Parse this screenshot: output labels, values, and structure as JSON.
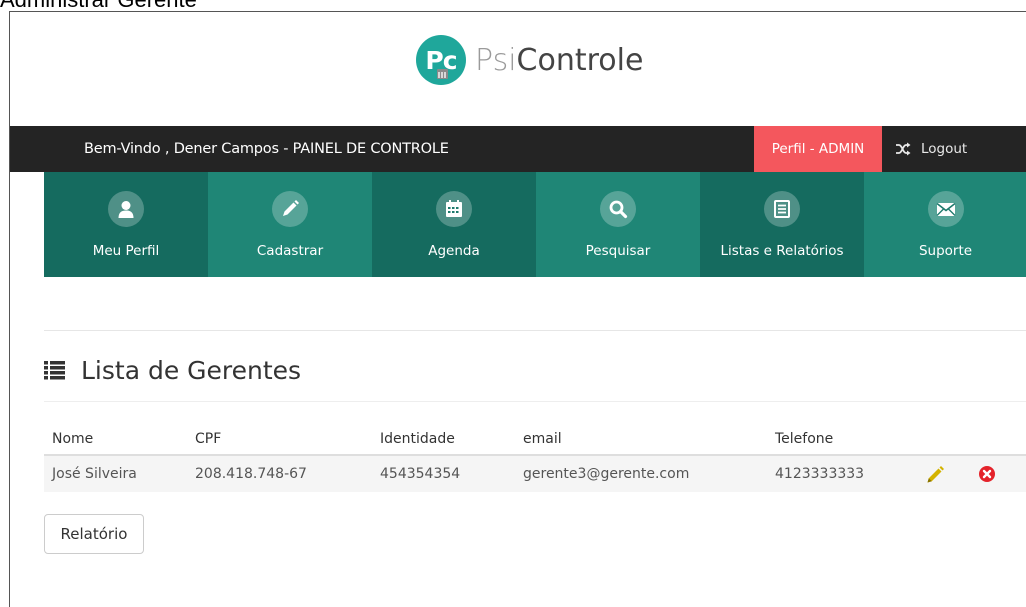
{
  "page_caption": "Administrar Gerente",
  "logo": {
    "badge": "Pc",
    "psi": "Psi",
    "controle": "Controle"
  },
  "topbar": {
    "welcome": "Bem-Vindo , Dener  Campos - PAINEL DE CONTROLE",
    "profile_button": "Perfil - ADMIN",
    "logout": "Logout"
  },
  "nav": {
    "items": [
      {
        "label": "Meu Perfil",
        "icon": "user-icon",
        "color": "#156b5f"
      },
      {
        "label": "Cadastrar",
        "icon": "pencil-icon",
        "color": "#1f8676"
      },
      {
        "label": "Agenda",
        "icon": "calendar-icon",
        "color": "#156b5f"
      },
      {
        "label": "Pesquisar",
        "icon": "search-icon",
        "color": "#1f8676"
      },
      {
        "label": "Listas e Relatórios",
        "icon": "list-icon",
        "color": "#156b5f"
      },
      {
        "label": "Suporte",
        "icon": "envelope-icon",
        "color": "#1f8676"
      }
    ]
  },
  "section": {
    "title": "Lista de Gerentes"
  },
  "table": {
    "headers": [
      "Nome",
      "CPF",
      "Identidade",
      "email",
      "Telefone"
    ],
    "rows": [
      [
        "José Silveira",
        "208.418.748-67",
        "454354354",
        "gerente3@gerente.com",
        "4123333333"
      ]
    ]
  },
  "report_button": "Relatório",
  "colors": {
    "brand_teal": "#1fa79b",
    "topbar": "#242424",
    "profile_accent": "#f4575d",
    "edit": "#d4b300",
    "delete": "#e4232b"
  }
}
